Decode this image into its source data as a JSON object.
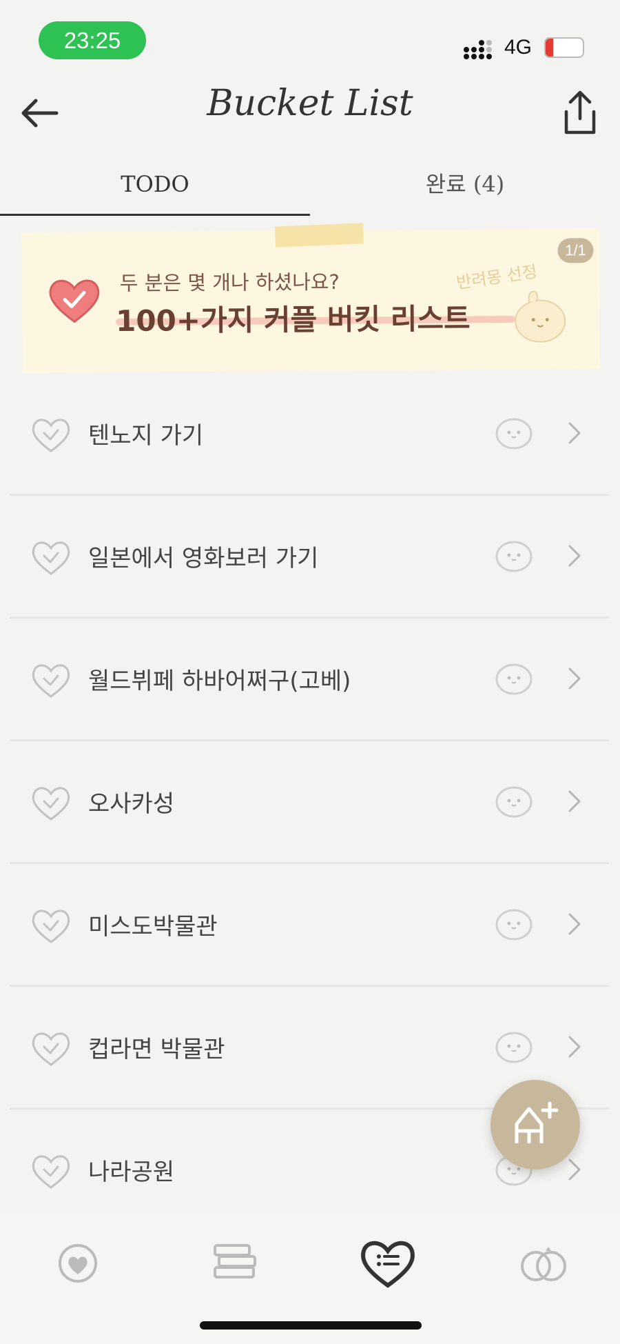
{
  "status_bar": {
    "time": "23:25",
    "network": "4G",
    "battery": "20",
    "battery_level": 0.2
  },
  "header": {
    "title": "Bucket List"
  },
  "tabs": [
    {
      "label": "TODO",
      "active": true
    },
    {
      "label": "완료 (4)",
      "active": false
    }
  ],
  "banner": {
    "question": "두 분은 몇 개나 하셨나요?",
    "headline": "100+가지 커플 버킷 리스트",
    "pick_label": "반려몽 선정",
    "page": "1/1"
  },
  "bucket_items": [
    {
      "label": "텐노지 가기"
    },
    {
      "label": "일본에서 영화보러 가기"
    },
    {
      "label": "월드뷔페 하바어쩌구(고베)"
    },
    {
      "label": "오사카성"
    },
    {
      "label": "미스도박물관"
    },
    {
      "label": "컵라면 박물관"
    },
    {
      "label": "나라공원"
    }
  ],
  "icons": {
    "back": "arrow-left-icon",
    "share": "share-icon",
    "item_status": "heart-check-icon",
    "item_face": "face-icon",
    "fab": "add-bucket-icon",
    "nav": [
      "heart-home-icon",
      "book-stack-icon",
      "bucket-list-icon",
      "rings-icon"
    ]
  },
  "colors": {
    "accent": "#c7b89b",
    "time_pill": "#2ec153",
    "banner_bg": "#fdf6e0",
    "banner_heart": "#ef7d7d"
  }
}
